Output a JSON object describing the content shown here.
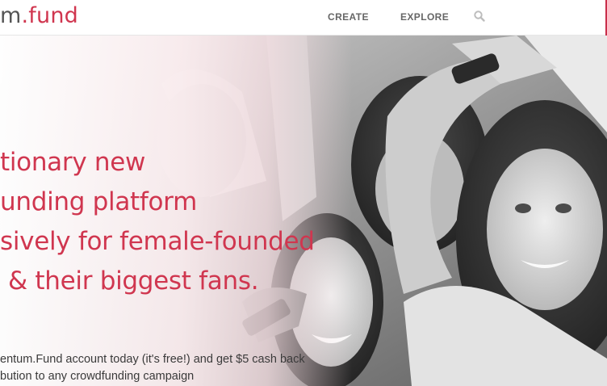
{
  "header": {
    "logo_prefix": "m",
    "logo_accent": ".fund",
    "nav": {
      "create_label": "CREATE",
      "explore_label": "EXPLORE"
    },
    "search_icon": "search-icon"
  },
  "hero": {
    "headline_lines": [
      "tionary new",
      "unding platform",
      "sively for female-founded",
      "& their biggest fans."
    ],
    "subtext_lines": [
      "entum.Fund account today (it's free!) and get $5 cash back",
      "bution to any crowdfunding campaign"
    ]
  },
  "colors": {
    "brand": "#d0364f",
    "nav_text": "#666666",
    "body_text": "#3a3a3a"
  }
}
